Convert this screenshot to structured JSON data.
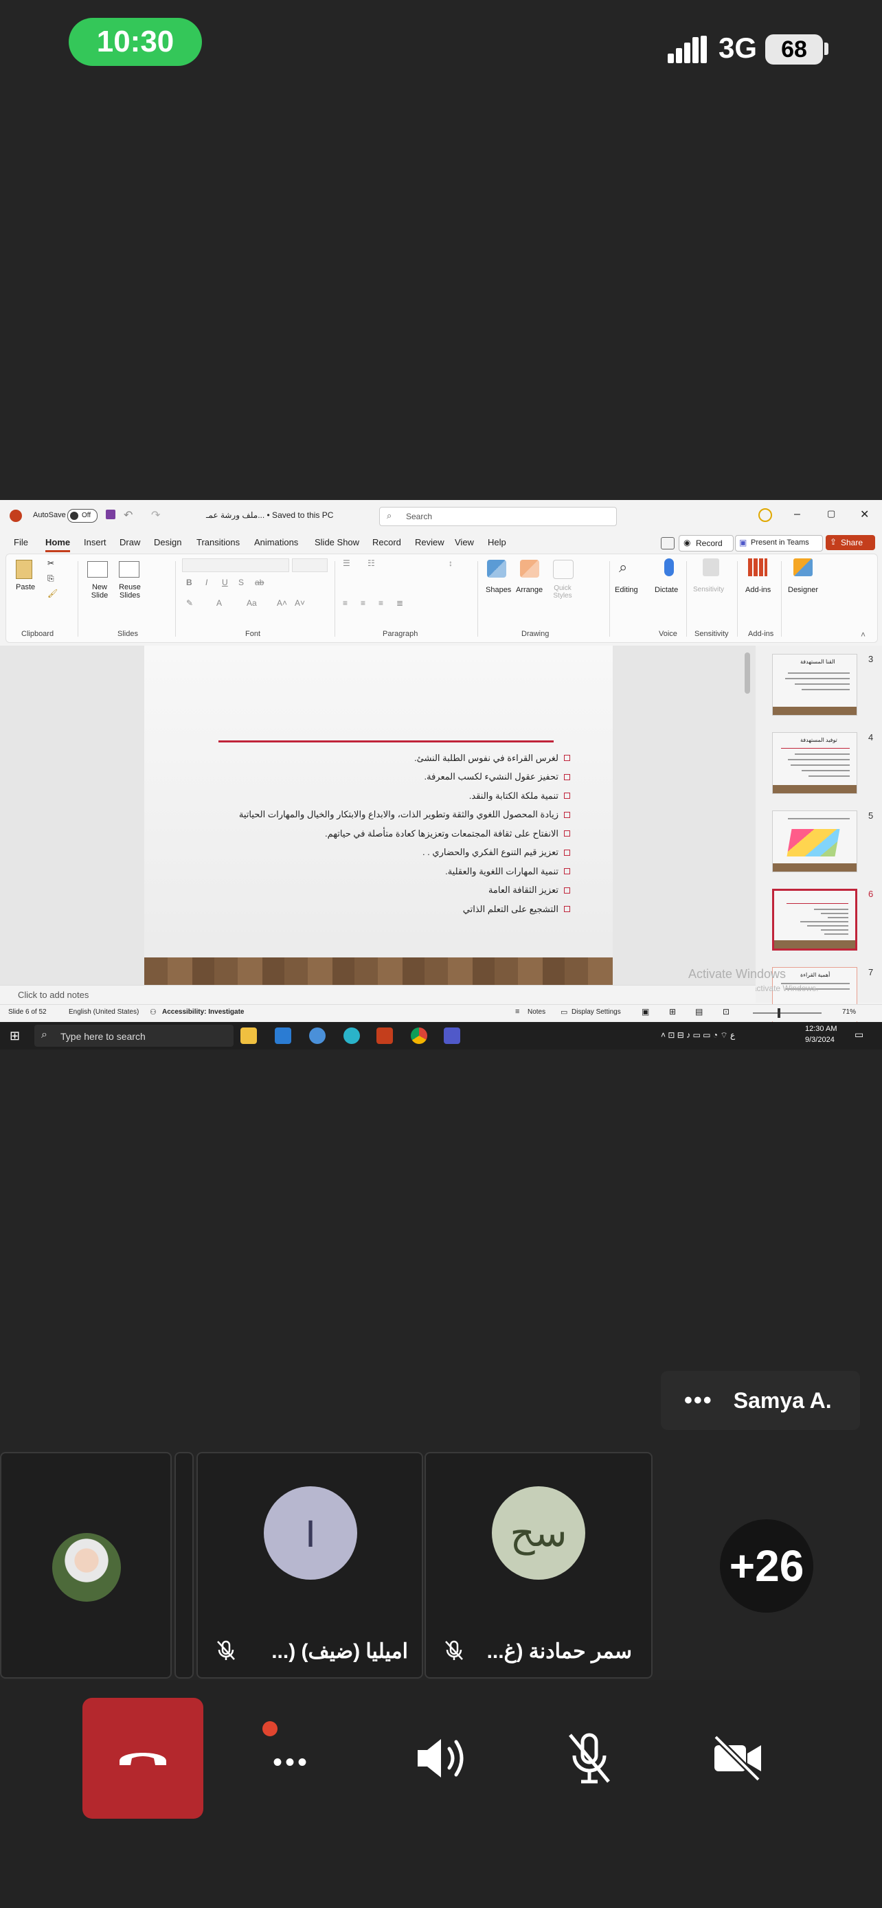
{
  "status_bar": {
    "time": "10:30",
    "network": "3G",
    "battery": "68"
  },
  "app": {
    "autosave_label": "AutoSave",
    "autosave_state": "Off",
    "doc_title": "ملف ورشة عمـ... • Saved to this PC",
    "search_placeholder": "Search",
    "menu": [
      "File",
      "Home",
      "Insert",
      "Draw",
      "Design",
      "Transitions",
      "Animations",
      "Slide Show",
      "Record",
      "Review",
      "View",
      "Help"
    ],
    "record_label": "Record",
    "present_label": "Present in Teams",
    "share_label": "Share",
    "ribbon": {
      "paste": "Paste",
      "new_slide": "New Slide",
      "reuse_slides": "Reuse Slides",
      "shapes": "Shapes",
      "arrange": "Arrange",
      "quick_styles": "Quick Styles",
      "editing": "Editing",
      "dictate": "Dictate",
      "sensitivity": "Sensitivity",
      "add_ins": "Add-ins",
      "designer": "Designer",
      "groups": [
        "Clipboard",
        "Slides",
        "Font",
        "Paragraph",
        "Drawing",
        "Voice",
        "Sensitivity",
        "Add-ins"
      ]
    },
    "slide_bullets": [
      "لغرس القراءة في نفوس الطلبة النشئ.",
      "تحفيز عقول النشيء لكسب المعرفة.",
      "تنمية ملكة الكتابة والنقد.",
      "زيادة المحصول اللغوي والثقة وتطوير الذات، والابداع والابتكار والخيال والمهارات الحياتية",
      "الانفتاح على ثقافة المجتمعات وتعزيزها كعادة متأصلة في حياتهم.",
      "تعزيز قيم التنوع الفكري والحضاري . .",
      "تنمية المهارات اللغوية والعقلية.",
      "تعزيز الثقافة العامة",
      "التشجيع على التعلم الذاتي"
    ],
    "thumbnails": [
      {
        "num": "3",
        "title": "القنا المستهدفة"
      },
      {
        "num": "4",
        "title": "توفيد المستهدفة"
      },
      {
        "num": "5",
        "title": ""
      },
      {
        "num": "6",
        "title": ""
      },
      {
        "num": "7",
        "title": "أهمية القراءة"
      }
    ],
    "notes_placeholder": "Click to add notes",
    "watermark_title": "Activate Windows",
    "watermark_sub": "Go to Settings to activate Windows.",
    "status": {
      "slide": "Slide 6 of 52",
      "language": "English (United States)",
      "accessibility": "Accessibility: Investigate",
      "notes": "Notes",
      "display": "Display Settings",
      "zoom": "71%"
    },
    "taskbar": {
      "search": "Type here to search",
      "time": "12:30 AM",
      "date": "9/3/2024"
    }
  },
  "meeting": {
    "speaker": "Samya A.",
    "participants": [
      {
        "name": "",
        "initials": ""
      },
      {
        "name": "اميليا (ضيف) (...",
        "initials": "I"
      },
      {
        "name": "سمر حمادنة (غ...",
        "initials": "سح"
      }
    ],
    "more_count": "+26"
  },
  "colors": {
    "accent_green": "#34c759",
    "hangup_red": "#b4282d",
    "ppt_red": "#c0243a"
  }
}
